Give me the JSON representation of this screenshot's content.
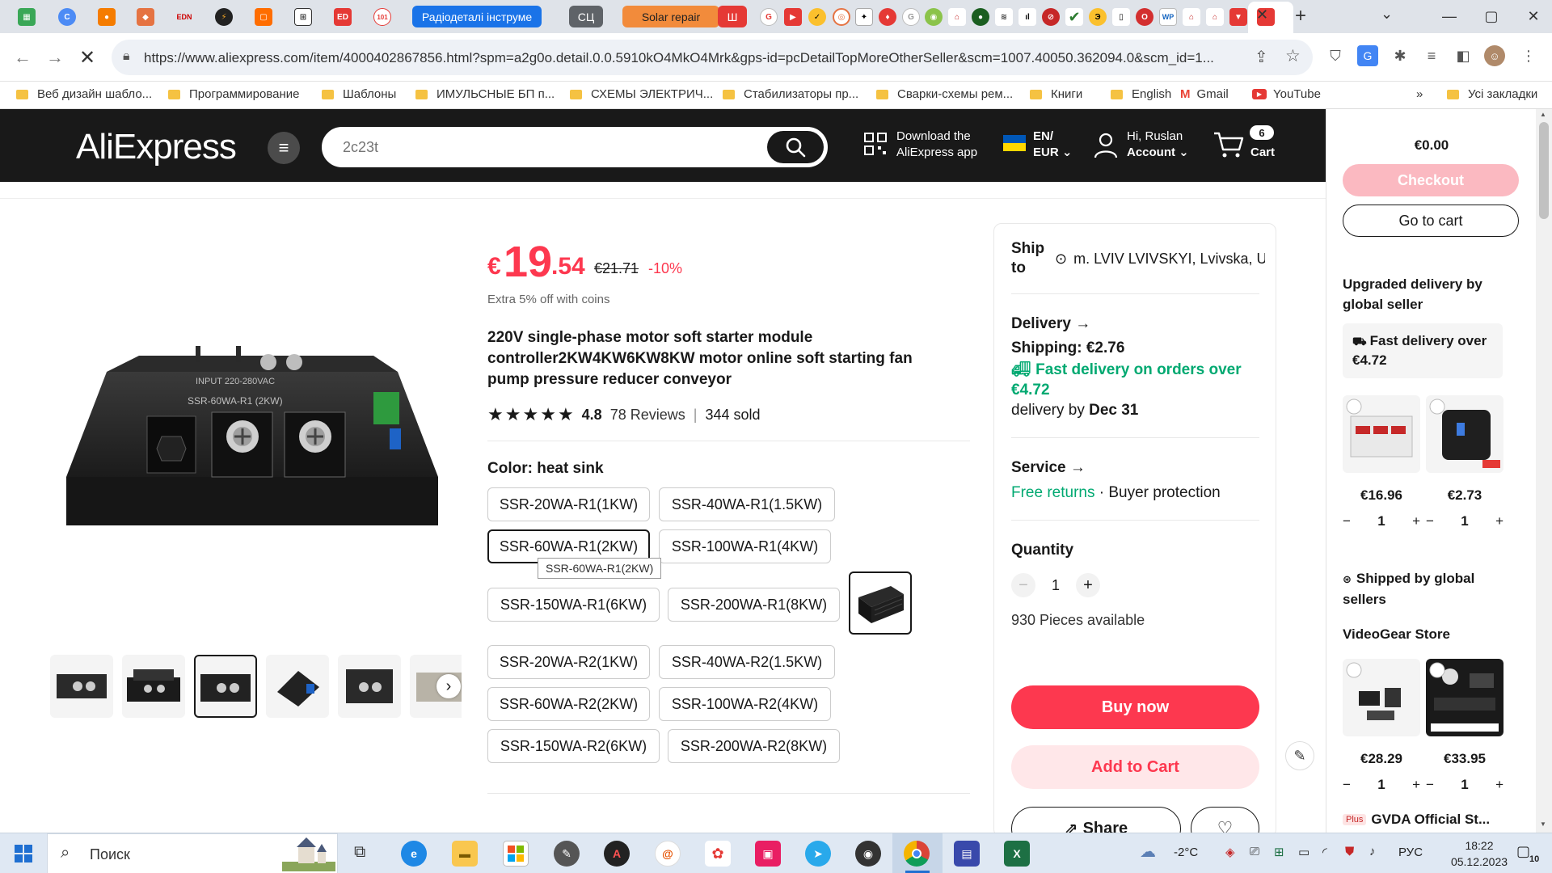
{
  "browser": {
    "tabs": {
      "radiodetali": "Радіодеталі інструме",
      "sc": "СЦ",
      "solar": "Solar repair",
      "sh": "Ш"
    },
    "url": "https://www.aliexpress.com/item/4000402867856.html?spm=a2g0o.detail.0.0.5910kO4MkO4Mrk&gps-id=pcDetailTopMoreOtherSeller&scm=1007.40050.362094.0&scm_id=1...",
    "bookmarks": [
      "Веб дизайн шабло...",
      "Программирование",
      "Шаблоны",
      "ИМУЛЬСНЫЕ БП п...",
      "СХЕМЫ ЭЛЕКТРИЧ...",
      "Стабилизаторы пр...",
      "Сварки-схемы рем...",
      "Книги",
      "English",
      "Gmail",
      "YouTube"
    ],
    "bookmarks_more": "»",
    "all_bookmarks": "Усі закладки"
  },
  "header": {
    "logo": "AliExpress",
    "search_placeholder": "2c23t",
    "download_line1": "Download the",
    "download_line2": "AliExpress app",
    "lang_line1": "EN/",
    "lang_line2": "EUR",
    "account_line1": "Hi, Ruslan",
    "account_line2": "Account",
    "cart_count": "6",
    "cart_label": "Cart"
  },
  "product": {
    "price_currency": "€",
    "price_int": "19",
    "price_dec": ".54",
    "price_old": "€21.71",
    "discount": "-10%",
    "coins_note": "Extra 5% off with coins",
    "title": "220V single-phase motor soft starter module controller2KW4KW6KW8KW motor online soft starting fan pump pressure reducer conveyor",
    "rating": "4.8",
    "reviews": "78 Reviews",
    "sold": "344 sold",
    "color_label": "Color: heat sink",
    "options": [
      "SSR-20WA-R1(1KW)",
      "SSR-40WA-R1(1.5KW)",
      "SSR-60WA-R1(2KW)",
      "SSR-100WA-R1(4KW)",
      "SSR-150WA-R1(6KW)",
      "SSR-200WA-R1(8KW)",
      "SSR-20WA-R2(1KW)",
      "SSR-40WA-R2(1.5KW)",
      "SSR-60WA-R2(2KW)",
      "SSR-100WA-R2(4KW)",
      "SSR-150WA-R2(6KW)",
      "SSR-200WA-R2(8KW)"
    ],
    "tooltip": "SSR-60WA-R1(2KW)",
    "module_label_model": "SSR-60WA-R1 (2KW)"
  },
  "buybox": {
    "ship_to_label_1": "Ship",
    "ship_to_label_2": "to",
    "ship_to_value": "m. LVIV LVIVSKYI, Lvivska, Uk...",
    "delivery": "Delivery →",
    "shipping": "Shipping: €2.76",
    "fast_line1": "Fast delivery on orders over",
    "fast_line2": "€4.72",
    "delivery_by_label": "delivery by",
    "delivery_by_date": "Dec 31",
    "service": "Service →",
    "free_returns": "Free returns",
    "buyer_protection": "· Buyer protection",
    "quantity_label": "Quantity",
    "quantity": "1",
    "available": "930 Pieces available",
    "buy_now": "Buy now",
    "add_to_cart": "Add to Cart",
    "share": "Share"
  },
  "sidecart": {
    "total": "€0.00",
    "checkout": "Checkout",
    "go_to_cart": "Go to cart",
    "upgraded_line1": "Upgraded delivery by",
    "upgraded_line2": "global seller",
    "fast_line1": "Fast delivery over",
    "fast_line2": "€4.72",
    "items1": [
      {
        "price": "€16.96",
        "qty": "1"
      },
      {
        "price": "€2.73",
        "qty": "1"
      }
    ],
    "shipped_line1": "Shipped by global",
    "shipped_line2": "sellers",
    "store": "VideoGear Store",
    "items2": [
      {
        "price": "€28.29",
        "qty": "1"
      },
      {
        "price": "€33.95",
        "qty": "1"
      }
    ],
    "next_store_badge": "Plus",
    "next_store": "GVDA Official St..."
  },
  "taskbar": {
    "search": "Поиск",
    "weather": "-2°C",
    "lang": "РУС",
    "time": "18:22",
    "date": "05.12.2023",
    "notifications": "10"
  },
  "colors": {
    "accent": "#fd384f",
    "header_bg": "#191919",
    "green": "#00a971"
  }
}
